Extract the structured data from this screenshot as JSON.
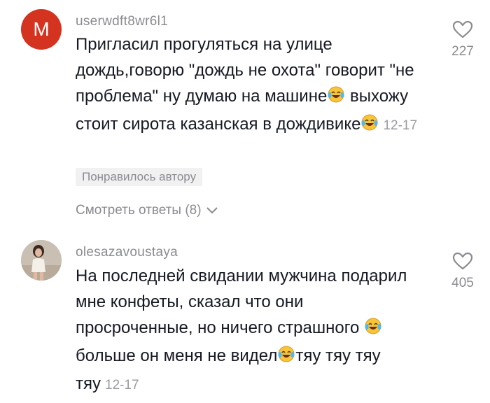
{
  "comments": [
    {
      "avatar_letter": "M",
      "username": "userwdft8wr6l1",
      "text_before_emoji_1": "Пригласил прогуляться на улице дождь,говорю \"дождь не охота\" говорит \"не проблема\" ну думаю на машине",
      "text_middle": "выхожу стоит сирота казанская в дождивике",
      "text_after": "",
      "date": "12-17",
      "liked_by_author_label": "Понравилось автору",
      "replies_label": "Смотреть ответы (8)",
      "likes": "227",
      "emoji": "laughing-tears"
    },
    {
      "username": "olesazavoustaya",
      "text_before_emoji_1": "На последней свидании мужчина подарил мне конфеты, сказал что они просроченные, но ничего страшного",
      "text_middle": "больше он меня не видел",
      "text_after": "тяу тяу тяу тяу",
      "date": "12-17",
      "likes": "405",
      "emoji": "laughing-tears"
    }
  ],
  "colors": {
    "avatar_bg": "#d3331f",
    "secondary_text": "#8a8b91",
    "primary_text": "#161823"
  }
}
